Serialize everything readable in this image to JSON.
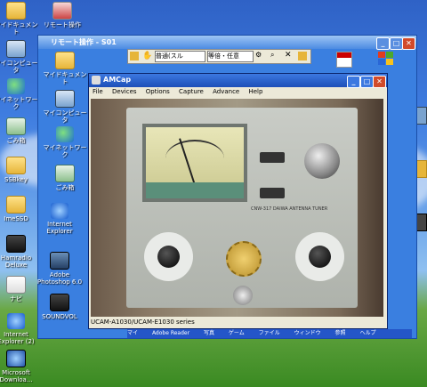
{
  "desktop": {
    "left_icons": [
      {
        "label": "マイドキュメント",
        "icon": "folder-icon"
      },
      {
        "label": "マイコンピュータ",
        "icon": "computer-icon"
      },
      {
        "label": "マイネットワーク",
        "icon": "network-icon"
      },
      {
        "label": "ごみ箱",
        "icon": "recycle-bin-icon"
      },
      {
        "label": "SSBkey",
        "icon": "folder-icon"
      },
      {
        "label": "ImeSSD",
        "icon": "folder-icon"
      },
      {
        "label": "Hamradio Deluxe",
        "icon": "app-icon"
      },
      {
        "label": "ナビ",
        "icon": "app-icon"
      },
      {
        "label": "Internet Explorer (2)",
        "icon": "ie-icon"
      },
      {
        "label": "Microsoft Downloa...",
        "icon": "app-icon"
      }
    ],
    "top_icons": [
      {
        "label": "リモート操作",
        "icon": "remote-icon"
      }
    ]
  },
  "remote_window": {
    "title": "リモート操作 - S01",
    "toolbar": {
      "mode_value": "普通(スル",
      "option_value": "等倍・任意"
    },
    "inner_icons": [
      {
        "label": "マイドキュメント",
        "icon": "folder-icon"
      },
      {
        "label": "マイコンピュータ",
        "icon": "computer-icon"
      },
      {
        "label": "マイネットワーク",
        "icon": "network-icon"
      },
      {
        "label": "ごみ箱",
        "icon": "recycle-bin-icon"
      },
      {
        "label": "Internet Explorer",
        "icon": "ie-icon"
      },
      {
        "label": "Adobe Photoshop 6.0",
        "icon": "app-icon"
      },
      {
        "label": "SOUNDVOL",
        "icon": "app-icon"
      }
    ]
  },
  "amcap_window": {
    "title": "AMCap",
    "menu": [
      "File",
      "Devices",
      "Options",
      "Capture",
      "Advance",
      "Help"
    ],
    "status": "UCAM-A1030/UCAM-E1030 series",
    "device": {
      "model": "CNW-317",
      "brand": "DAIWA",
      "product": "ANTENNA TUNER"
    }
  },
  "taskbar": {
    "items": [
      "マイ",
      "Adobe Reader",
      "写真",
      "ゲーム",
      "ファイル",
      "ウィンドウ",
      "参照",
      "ヘルプ",
      "...",
      "....",
      "....."
    ]
  }
}
